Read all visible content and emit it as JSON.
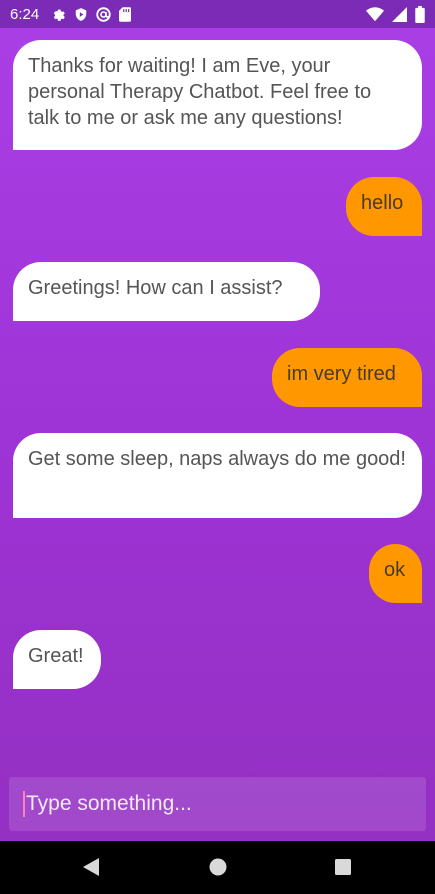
{
  "status_bar": {
    "time": "6:24",
    "left_icons": [
      "settings-icon",
      "shield-icon",
      "at-icon",
      "sd-card-icon"
    ],
    "right_icons": [
      "wifi-icon",
      "signal-icon",
      "battery-icon"
    ]
  },
  "messages": [
    {
      "sender": "bot",
      "text": "Thanks for waiting! I am Eve, your personal Therapy Chatbot. Feel free to talk to me or ask me any questions!"
    },
    {
      "sender": "user",
      "text": "hello"
    },
    {
      "sender": "bot",
      "text": "Greetings! How can I assist?"
    },
    {
      "sender": "user",
      "text": "im very tired"
    },
    {
      "sender": "bot",
      "text": "Get some sleep, naps always do me good!"
    },
    {
      "sender": "user",
      "text": "ok"
    },
    {
      "sender": "bot",
      "text": "Great!"
    }
  ],
  "composer": {
    "placeholder": "Type something...",
    "value": ""
  },
  "navigation_bar": {
    "buttons": [
      "back-icon",
      "home-icon",
      "recents-icon"
    ]
  },
  "colors": {
    "status_bar": "#7b2bb5",
    "background_top": "#a93ee5",
    "background_bottom": "#9430c2",
    "bot_bubble": "#ffffff",
    "user_bubble": "#ff9800"
  }
}
